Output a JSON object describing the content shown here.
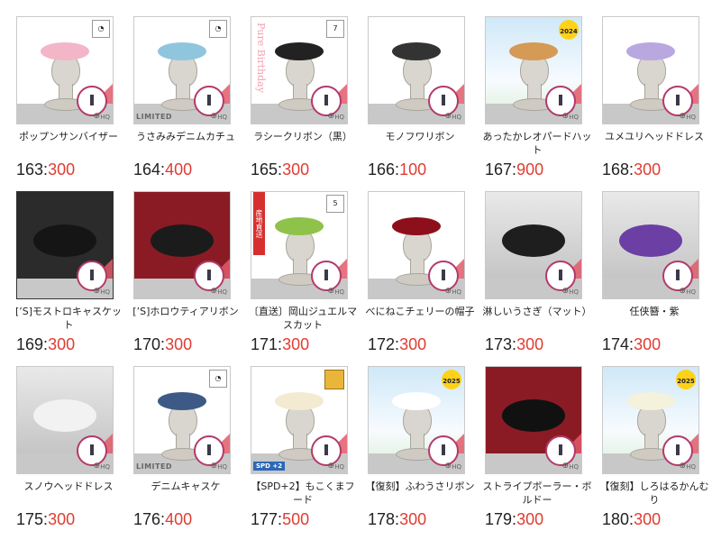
{
  "items": [
    {
      "name": "ポップンサンバイザー",
      "num": "163",
      "price": "300",
      "bg": "white",
      "badge": "icon",
      "item_color": "#f2b6c8"
    },
    {
      "name": "うさみみデニムカチュ",
      "num": "164",
      "price": "400",
      "bg": "white",
      "badge": "icon",
      "limited": "LIMITED",
      "item_color": "#8fc6de"
    },
    {
      "name": "ラシークリボン（黒）",
      "num": "165",
      "price": "300",
      "bg": "white",
      "badge": "7",
      "side_text": "Pure Birthday",
      "item_color": "#222222"
    },
    {
      "name": "モノフワリボン",
      "num": "166",
      "price": "100",
      "bg": "white",
      "item_color": "#333333"
    },
    {
      "name": "あったかレオパードハット",
      "num": "167",
      "price": "900",
      "bg": "sky",
      "badge": "2024",
      "item_color": "#d59a55"
    },
    {
      "name": "ユメユリヘッドドレス",
      "num": "168",
      "price": "300",
      "bg": "white",
      "item_color": "#b9a7e0"
    },
    {
      "name": "[’S]モストロキャスケット",
      "num": "169",
      "price": "300",
      "bg": "dark",
      "item_color": "#151515"
    },
    {
      "name": "[’S]ホロウティアリボン",
      "num": "170",
      "price": "300",
      "bg": "red",
      "item_color": "#1b1b1b"
    },
    {
      "name": "〔直送〕岡山ジュエルマスカット",
      "num": "171",
      "price": "300",
      "bg": "white",
      "badge": "5",
      "ribbon": "産地直送",
      "item_color": "#8fc24a"
    },
    {
      "name": "べにねこチェリーの帽子",
      "num": "172",
      "price": "300",
      "bg": "white",
      "item_color": "#8d0f1c"
    },
    {
      "name": "淋しいうさぎ（マット）",
      "num": "173",
      "price": "300",
      "bg": "gray",
      "item_color": "#1e1e1e"
    },
    {
      "name": "任侠簪・紫",
      "num": "174",
      "price": "300",
      "bg": "gray",
      "item_color": "#6b3fa3"
    },
    {
      "name": "スノウヘッドドレス",
      "num": "175",
      "price": "300",
      "bg": "gray",
      "item_color": "#f2f2f2"
    },
    {
      "name": "デニムキャスケ",
      "num": "176",
      "price": "400",
      "bg": "white",
      "badge": "icon",
      "limited": "LIMITED",
      "item_color": "#3d5a86"
    },
    {
      "name": "【SPD+2】もこくまフード",
      "num": "177",
      "price": "500",
      "bg": "white",
      "crown": "CHOCO",
      "spd": "SPD +2",
      "item_color": "#f3ead2"
    },
    {
      "name": "【復刻】ふわうさリボン",
      "num": "178",
      "price": "300",
      "bg": "sky",
      "badge": "2025",
      "item_color": "#ffffff"
    },
    {
      "name": "ストライプボーラー・ボルドー",
      "num": "179",
      "price": "300",
      "bg": "red",
      "item_color": "#111111"
    },
    {
      "name": "【復刻】しろはるかんむり",
      "num": "180",
      "price": "300",
      "bg": "sky",
      "badge": "2025",
      "item_color": "#f4f1dc"
    }
  ],
  "labels": {
    "hq": "HQ",
    "zoom": "⊕",
    "separator": ":"
  }
}
